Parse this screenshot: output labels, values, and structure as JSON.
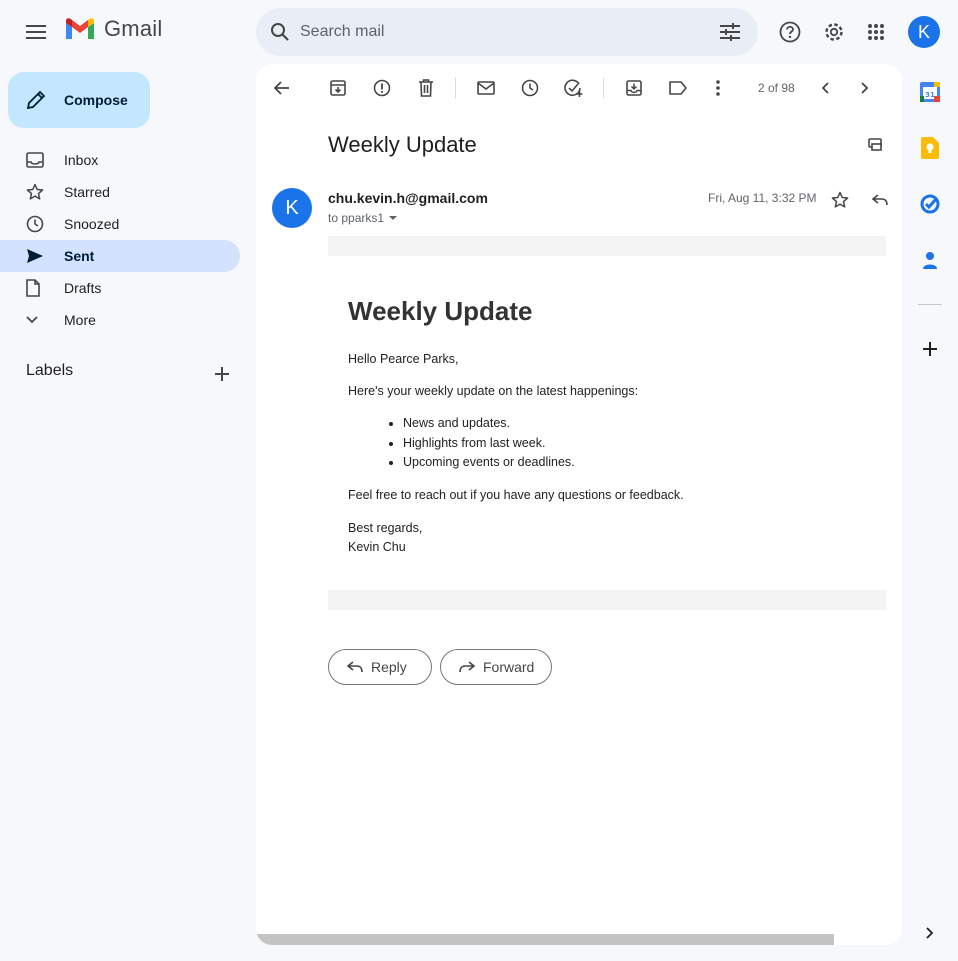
{
  "app": {
    "name": "Gmail"
  },
  "search": {
    "placeholder": "Search mail"
  },
  "user": {
    "initial": "K"
  },
  "compose": {
    "label": "Compose"
  },
  "nav": [
    {
      "label": "Inbox",
      "icon": "inbox-icon"
    },
    {
      "label": "Starred",
      "icon": "star-icon"
    },
    {
      "label": "Snoozed",
      "icon": "clock-icon"
    },
    {
      "label": "Sent",
      "icon": "send-icon",
      "active": true
    },
    {
      "label": "Drafts",
      "icon": "draft-icon"
    },
    {
      "label": "More",
      "icon": "chevron-down-icon"
    }
  ],
  "labels": {
    "title": "Labels"
  },
  "pager": {
    "text": "2 of 98"
  },
  "email": {
    "subject": "Weekly Update",
    "sender_initial": "K",
    "sender": "chu.kevin.h@gmail.com",
    "recipient": "to pparks1",
    "date": "Fri, Aug 11, 3:32 PM",
    "heading": "Weekly Update",
    "greeting": "Hello Pearce Parks,",
    "intro": "Here's your weekly update on the latest happenings:",
    "bullets": [
      "News and updates.",
      "Highlights from last week.",
      "Upcoming events or deadlines."
    ],
    "closing": "Feel free to reach out if you have any questions or feedback.",
    "signoff": "Best regards,",
    "signature": "Kevin Chu"
  },
  "actions": {
    "reply": "Reply",
    "forward": "Forward"
  },
  "colors": {
    "accent": "#1a73e8",
    "compose_bg": "#c2e7ff",
    "active_nav": "#d3e3fd",
    "background": "#f6f8fc"
  }
}
